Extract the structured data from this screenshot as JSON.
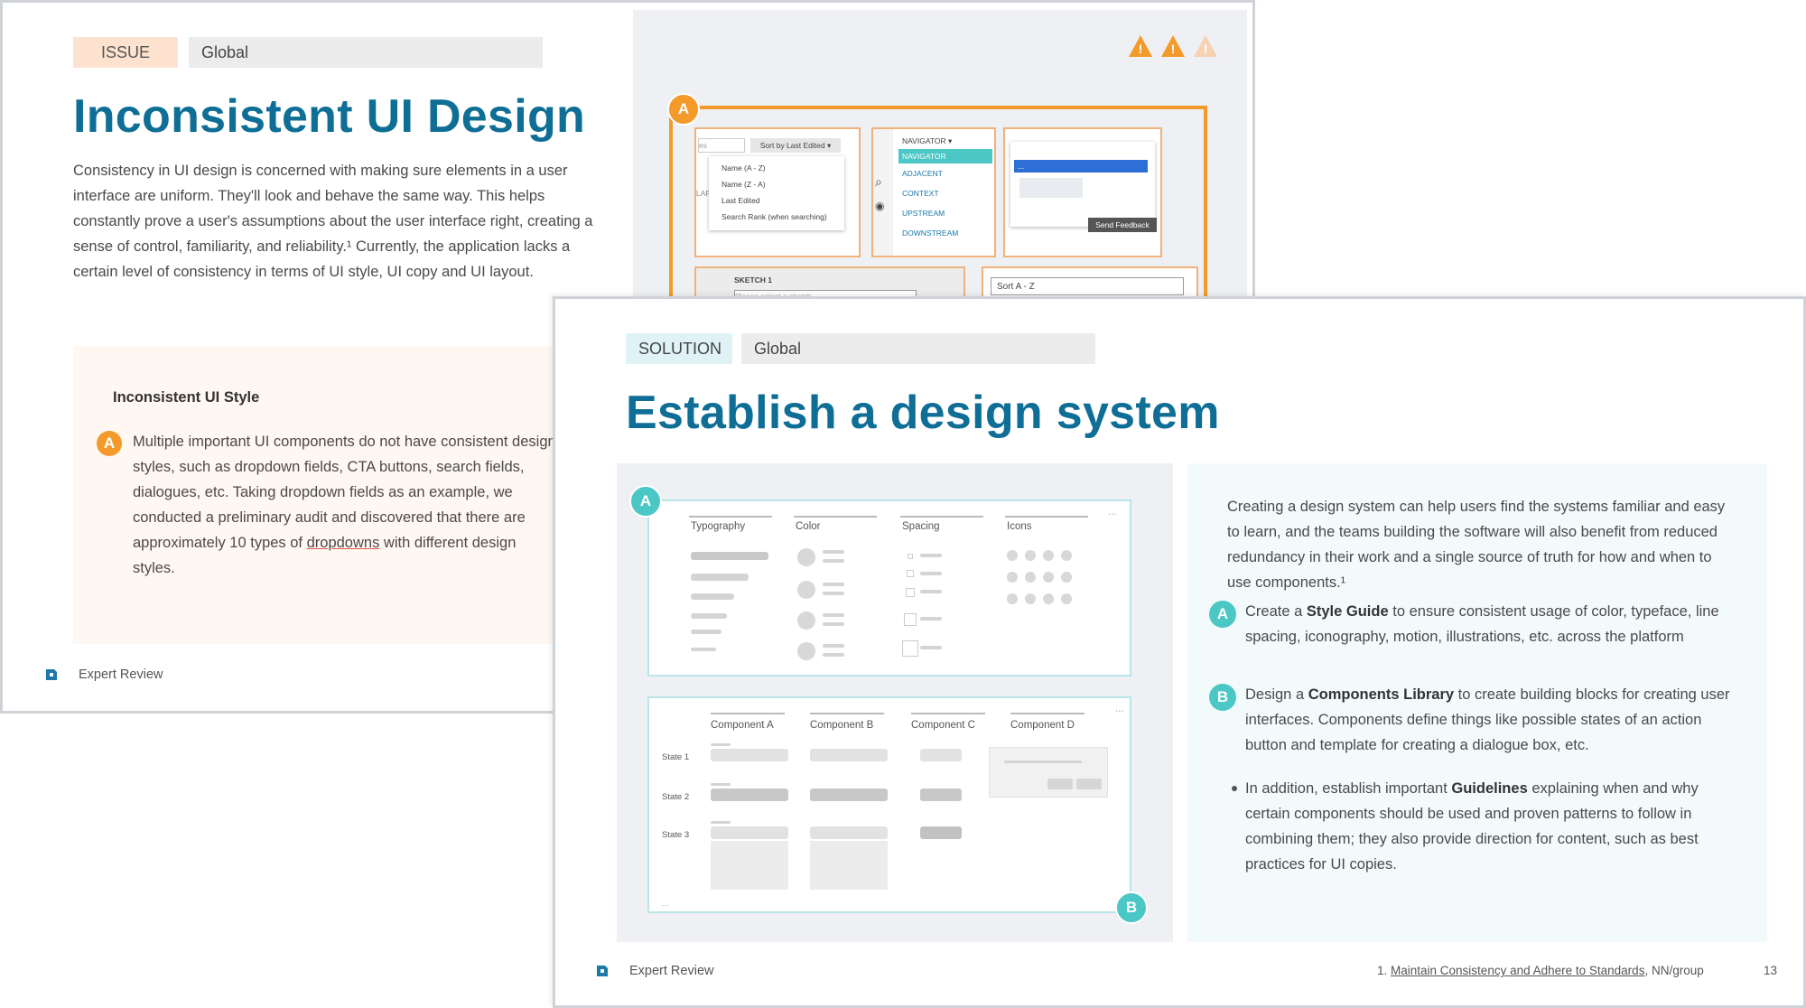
{
  "issue_slide": {
    "tag": "ISSUE",
    "scope": "Global",
    "title": "Inconsistent UI Design",
    "paragraph": "Consistency in UI design is concerned with making sure elements in a user interface are uniform. They'll look and behave the same way. This helps constantly prove a user's assumptions about the user interface right, creating a sense of control, familiarity, and reliability.¹ Currently, the application lacks a certain level of consistency in terms of UI style, UI copy and UI layout.",
    "callout": {
      "heading": "Inconsistent UI Style",
      "badge": "A",
      "text_before": "Multiple important UI components do not have consistent design styles, such as dropdown fields, CTA buttons, search fields, dialogues, etc. Taking dropdown fields as an example, we conducted a preliminary audit and discovered that there are approximately 10 types of ",
      "text_link": "dropdowns",
      "text_after": " with different design styles."
    },
    "footer": "Expert Review",
    "screenshot": {
      "badge": "A",
      "sort_button": "Sort by Last Edited ▾",
      "search_stub": "es",
      "sort_options": [
        "Name (A - Z)",
        "Name (Z - A)",
        "Last Edited",
        "Search Rank (when searching)"
      ],
      "side_stub": "LAR",
      "navigator_button": "NAVIGATOR ▾",
      "navigator_options": [
        "NAVIGATOR",
        "ADJACENT",
        "CONTEXT",
        "UPSTREAM",
        "DOWNSTREAM"
      ],
      "dialog_selected": "...",
      "dialog_button": "Send Feedback",
      "sketch_label": "SKETCH 1",
      "sketch_placeholder": "Please select a sketch",
      "sort_select": "Sort A - Z"
    },
    "warning_count": 3,
    "colors": {
      "accent": "#0f6e96",
      "issue_tag_bg": "#fde3cf",
      "orange": "#f39a2b"
    }
  },
  "solution_slide": {
    "tag": "SOLUTION",
    "scope": "Global",
    "title": "Establish a design system",
    "intro": "Creating a design system can help users find the systems familiar and easy to learn, and the teams building the software will also benefit from reduced redundancy in their work and a single source of truth for how and when to use components.¹",
    "item_a": {
      "badge": "A",
      "pre": "Create a ",
      "bold": "Style Guide",
      "post": " to ensure consistent usage of color, typeface, line spacing, iconography, motion, illustrations, etc. across the platform"
    },
    "item_b": {
      "badge": "B",
      "pre": "Design a ",
      "bold": "Components Library",
      "post": " to create building blocks for creating user interfaces. Components define things like possible states of an action button and template for creating a dialogue box, etc."
    },
    "item_c": {
      "pre": "In addition, establish important ",
      "bold": "Guidelines",
      "post": " explaining when and why certain components should be used and proven patterns to follow in combining them; they also provide direction for content, such as best practices for UI copies."
    },
    "style_guide": {
      "badge": "A",
      "columns": [
        "Typography",
        "Color",
        "Spacing",
        "Icons"
      ],
      "more": "..."
    },
    "components": {
      "badge": "B",
      "columns": [
        "Component A",
        "Component B",
        "Component C",
        "Component D"
      ],
      "states": [
        "State 1",
        "State 2",
        "State 3"
      ],
      "more": "..."
    },
    "footer": "Expert Review",
    "citation_prefix": "1. ",
    "citation_link": "Maintain Consistency and Adhere to Standards",
    "citation_suffix": ", NN/group",
    "page_number": "13",
    "colors": {
      "solution_tag_bg": "#dff3f6",
      "teal": "#4bc7c6"
    }
  }
}
